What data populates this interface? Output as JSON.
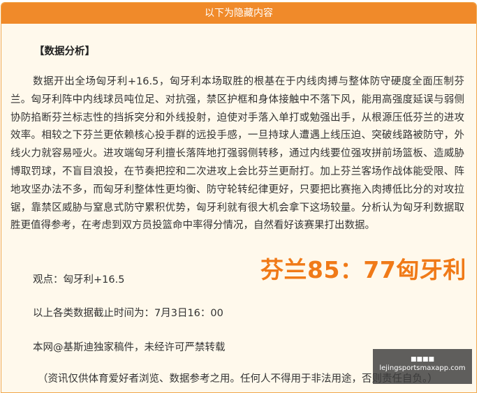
{
  "header": {
    "title": "以下为隐藏内容"
  },
  "article": {
    "section_title": "【数据分析】",
    "paragraph": "数据开出全场匈牙利+16.5，匈牙利本场取胜的根基在于内线肉搏与整体防守硬度全面压制芬兰。匈牙利阵中内线球员吨位足、对抗强，禁区护框和身体接触中不落下风，能用高强度延误与弱侧协防掐断芬兰标志性的挡拆突分和外线投射，迫使对手落入单打或勉强出手，从根源压低芬兰的进攻效率。相较之下芬兰更依赖核心投手群的远投手感，一旦持球人遭遇上线压迫、突破线路被防守，外线火力就容易哑火。进攻端匈牙利擅长落阵地打强弱侧转移，通过内线要位强攻拼前场篮板、造威胁博取罚球，不盲目浪投，在节奏把控和二次进攻上会比芬兰更耐打。加上芬兰客场作战体能受限、阵地攻坚办法不多，而匈牙利整体性更均衡、防守轮转纪律更好，只要把比赛拖入肉搏低比分的对攻拉锯，靠禁区威胁与窒息式防守累积优势，匈牙利就有很大机会拿下这场较量。分析认为匈牙利数据取胜更值得参考，在考虑到双方员投篮命中率得分情况，自然看好该赛果打出数据。",
    "viewpoint": "观点：匈牙利+16.5",
    "deadline": "以上各类数据截止时间为：7月3日16：00",
    "copyright": "本网@基斯迪独家稿件，未经许可严禁转载",
    "disclaimer": "（资讯仅供体育爱好者浏览、数据参考之用。任何人不得用于非法用途，否则责任自负。）"
  },
  "score_overlay": "芬兰85：77匈牙利",
  "watermark": {
    "top_text": "■■■■",
    "url": "lejingsportsmaxapp.com"
  }
}
